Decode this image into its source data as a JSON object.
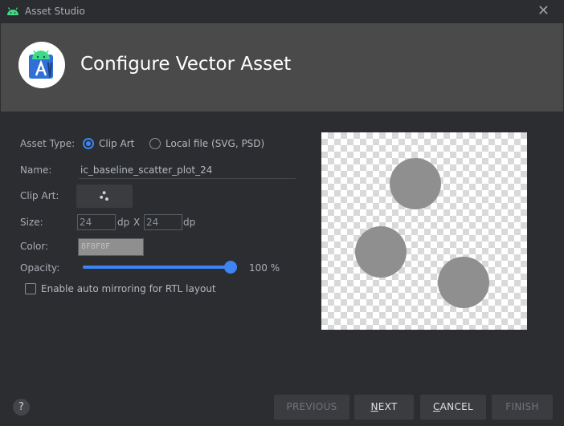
{
  "window": {
    "title": "Asset Studio",
    "close_label": "✕"
  },
  "header": {
    "heading": "Configure Vector Asset"
  },
  "form": {
    "asset_type": {
      "label": "Asset Type:",
      "options": [
        {
          "label": "Clip Art",
          "selected": true
        },
        {
          "label": "Local file (SVG, PSD)",
          "selected": false
        }
      ]
    },
    "name": {
      "label": "Name:",
      "value": "ic_baseline_scatter_plot_24"
    },
    "clip_art": {
      "label": "Clip Art:",
      "icon": "scatter-plot-icon"
    },
    "size": {
      "label": "Size:",
      "width": "24",
      "height": "24",
      "unit": "dp",
      "separator": "X"
    },
    "color": {
      "label": "Color:",
      "value": "8F8F8F"
    },
    "opacity": {
      "label": "Opacity:",
      "value": "100 %",
      "level": 1.0
    },
    "auto_mirror": {
      "label": "Enable auto mirroring for RTL layout",
      "checked": false
    }
  },
  "preview": {
    "icon": "scatter-plot-icon",
    "fill_color": "#8f8f8f"
  },
  "footer": {
    "help_label": "?",
    "buttons": {
      "previous": {
        "label": "PREVIOUS",
        "enabled": false
      },
      "next": {
        "mnemonic": "N",
        "rest": "EXT",
        "enabled": true
      },
      "cancel": {
        "mnemonic": "C",
        "rest": "ANCEL",
        "enabled": true
      },
      "finish": {
        "label": "FINISH",
        "enabled": false
      }
    }
  },
  "colors": {
    "accent": "#3d84f5",
    "background": "#2b2d30",
    "header_background": "#4a4a4a"
  }
}
